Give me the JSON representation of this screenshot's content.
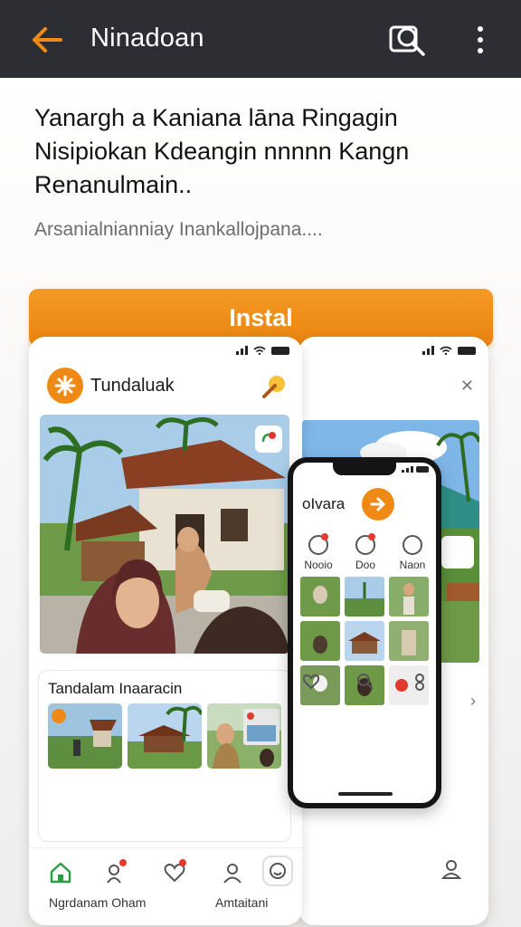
{
  "app_bar": {
    "title": "Ninadoan",
    "back_icon": "arrow-left-icon",
    "search_icon": "search-icon",
    "more_icon": "more-vertical-icon",
    "accent": "#f08a16",
    "background": "#2c2e33"
  },
  "main": {
    "headline": "Yanargh a Kaniana lāna Ringagin Nisipiokan Kdeangin nnnnn Kangn Renanulmain..",
    "subtext": "Arsanialnianniay Inankallojpana....",
    "install_label": "Instal",
    "install_color": "#f08a16"
  },
  "preview_left": {
    "brand_name": "Tundaluak",
    "card_title": "Tandalam Inaaracin",
    "nav": [
      {
        "icon": "home-icon",
        "label": "Ngrdanam Oham"
      },
      {
        "icon": "people-icon",
        "label": ""
      },
      {
        "icon": "heart-icon",
        "label": ""
      },
      {
        "icon": "profile-icon",
        "label": "Amtaitani"
      },
      {
        "icon": "chat-icon",
        "label": ""
      }
    ]
  },
  "preview_front": {
    "brand_name": "oIvara",
    "quick": [
      {
        "icon": "heart-icon",
        "label": "Nooio"
      },
      {
        "icon": "heart-icon",
        "label": "Doo"
      },
      {
        "icon": "minus-circle-icon",
        "label": "Naon"
      }
    ]
  }
}
